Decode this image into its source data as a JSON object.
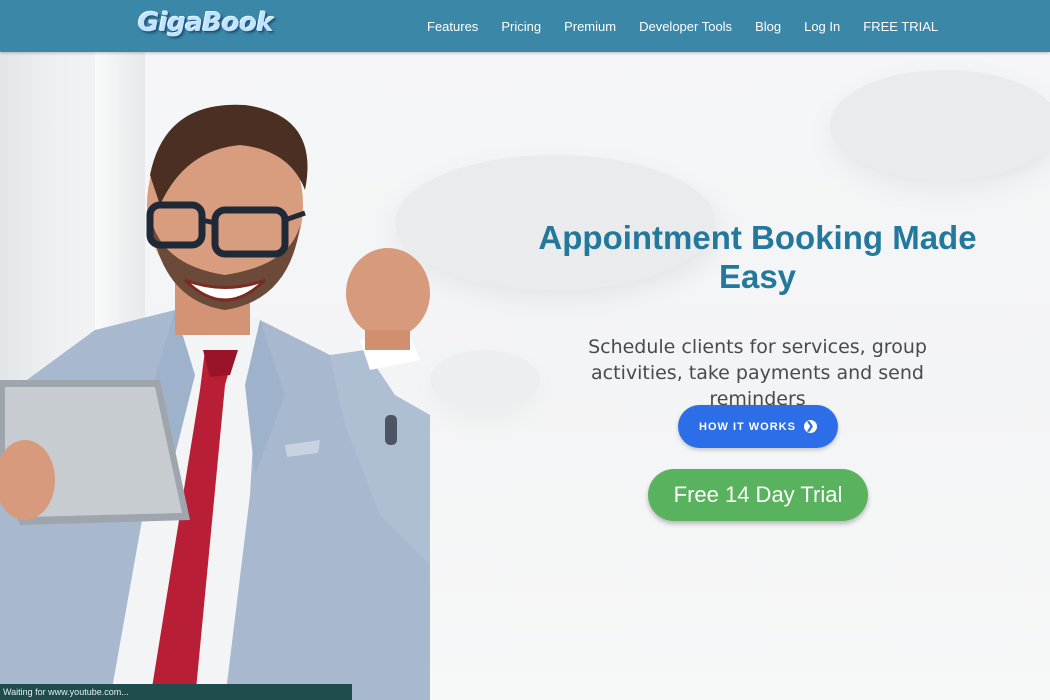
{
  "header": {
    "logo_text": "GigaBook",
    "nav": [
      {
        "label": "Features"
      },
      {
        "label": "Pricing"
      },
      {
        "label": "Premium"
      },
      {
        "label": "Developer Tools"
      },
      {
        "label": "Blog"
      },
      {
        "label": "Log In"
      },
      {
        "label": "FREE TRIAL"
      }
    ]
  },
  "hero": {
    "headline": "Appointment Booking Made Easy",
    "subheadline": "Schedule clients for services, group activities, take payments and send reminders",
    "how_it_works_label": "HOW IT WORKS",
    "trial_label": "Free 14 Day Trial"
  },
  "browser": {
    "status_text": "Waiting for www.youtube.com..."
  },
  "colors": {
    "nav_bg": "#3a87a8",
    "headline": "#23789c",
    "primary_button": "#2c6ee8",
    "trial_button": "#59b25d"
  },
  "icons": {
    "how_it_works": "chevron-right-circle-icon"
  }
}
